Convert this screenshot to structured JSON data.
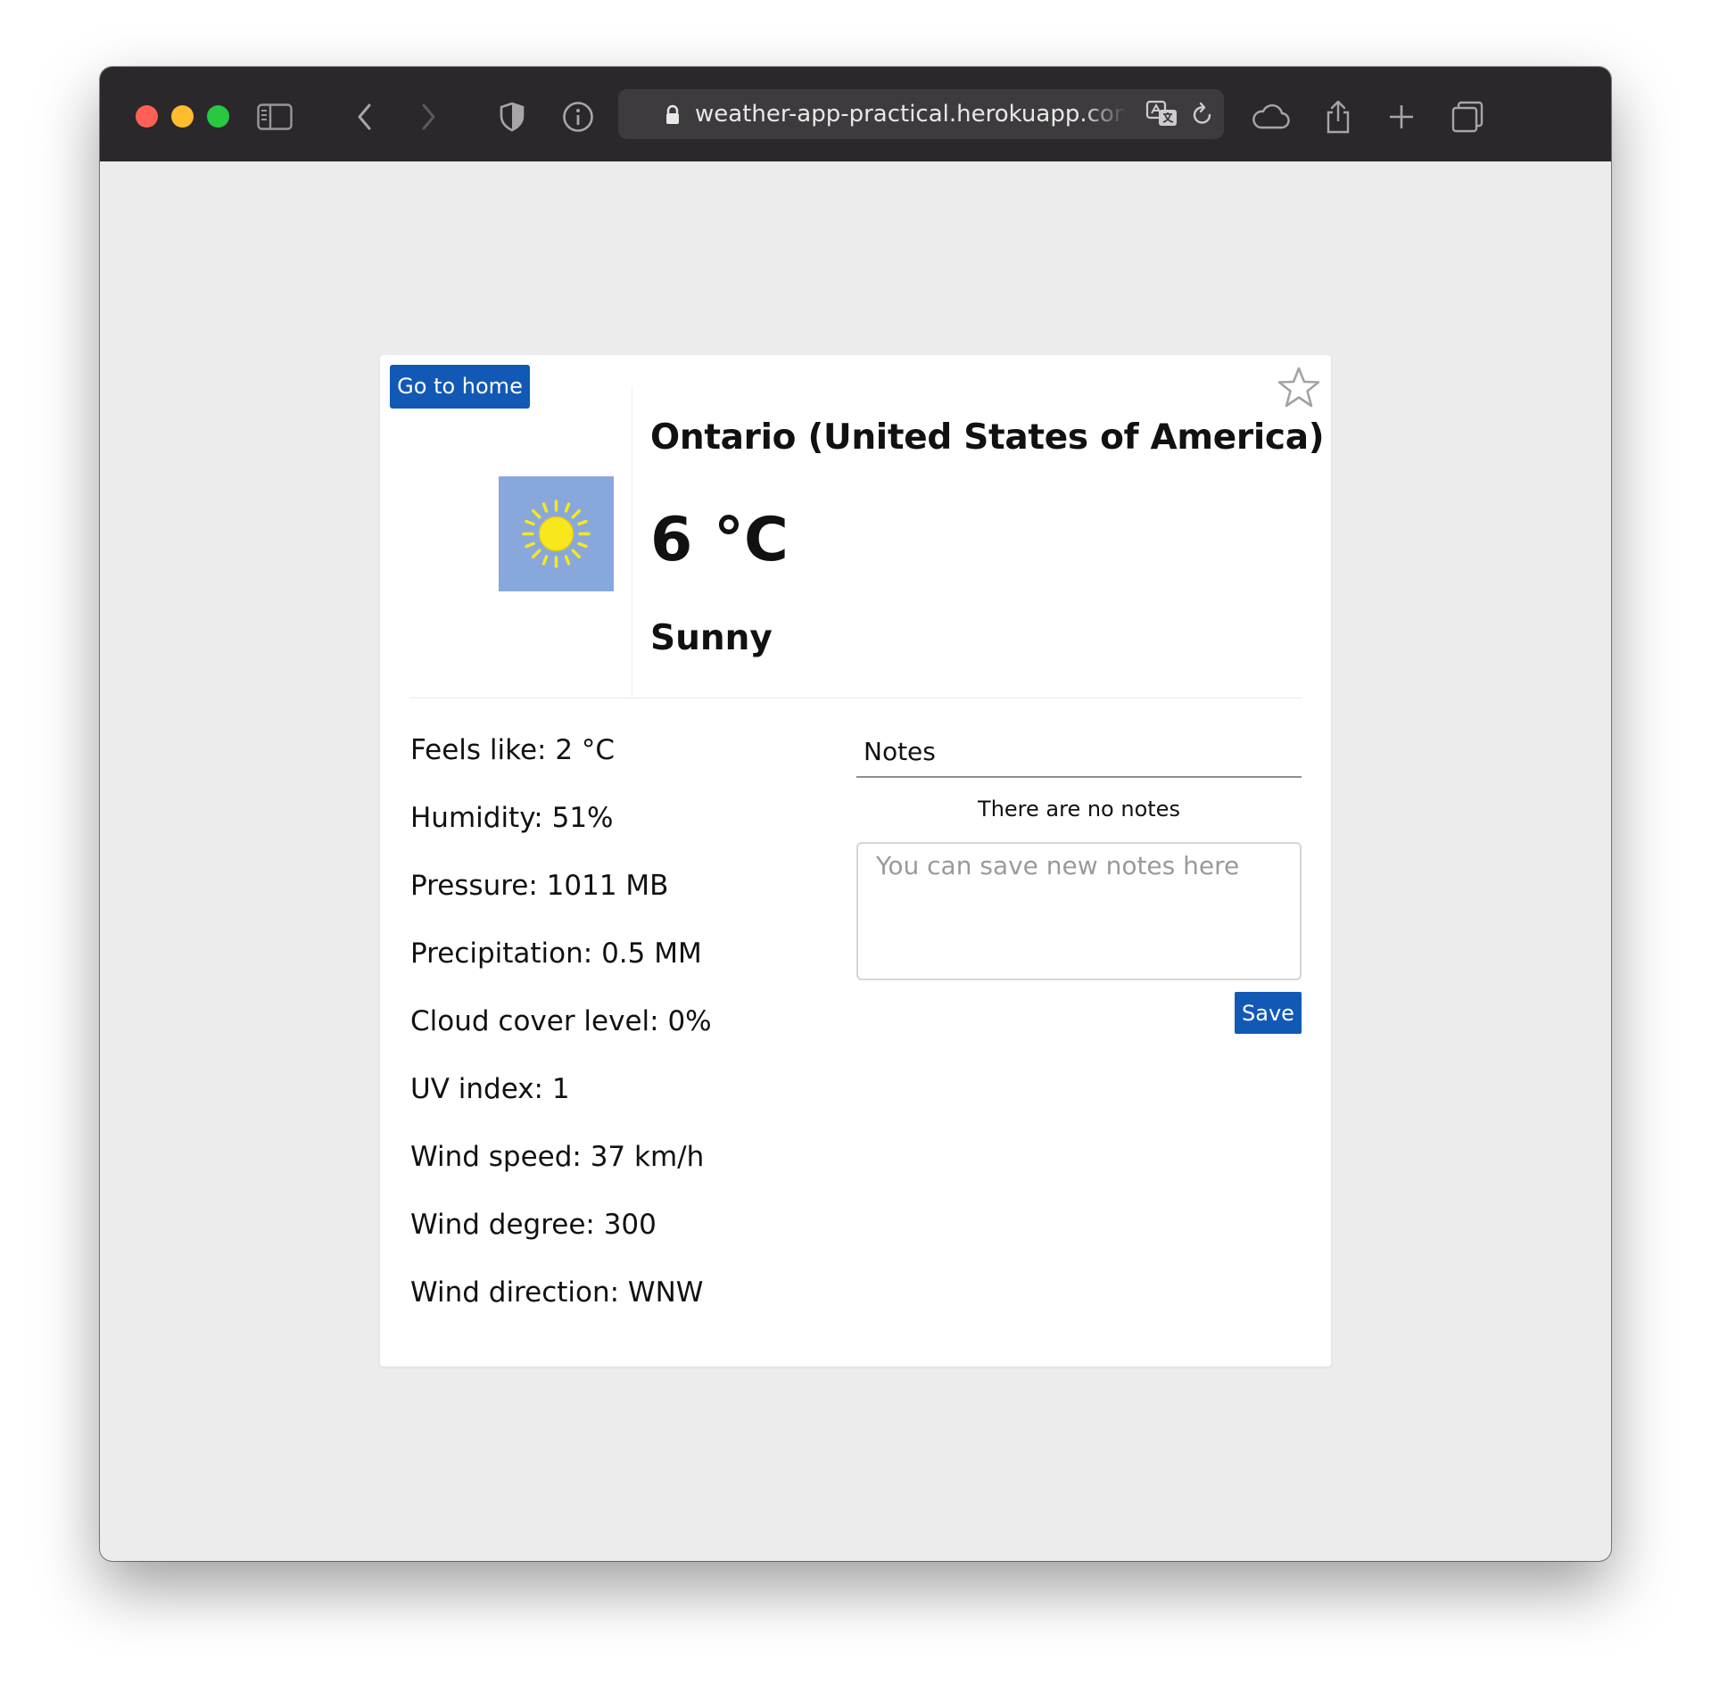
{
  "browser": {
    "url": "weather-app-practical.herokuapp.com/city"
  },
  "weather": {
    "home_button_label": "Go to home",
    "city": "Ontario (United States of America)",
    "temperature": "6 °C",
    "condition": "Sunny",
    "condition_icon": "sun-icon",
    "details": [
      "Feels like: 2 °C",
      "Humidity: 51%",
      "Pressure: 1011 MB",
      "Precipitation: 0.5 MM",
      "Cloud cover level: 0%",
      "UV index: 1",
      "Wind speed: 37 km/h",
      "Wind degree: 300",
      "Wind direction: WNW"
    ]
  },
  "notes": {
    "title": "Notes",
    "empty_message": "There are no notes",
    "input_placeholder": "You can save new notes here",
    "save_label": "Save"
  },
  "colors": {
    "accent": "#1259b6",
    "icon_background": "#88a8dc",
    "sun": "#f8e71c",
    "toolbar": "#2b282b"
  }
}
